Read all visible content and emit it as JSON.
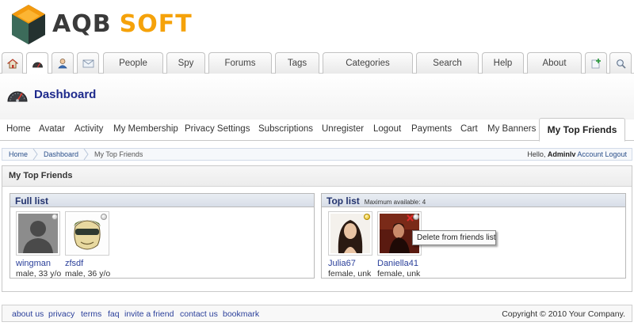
{
  "brand": {
    "name_part1": "AQB",
    "name_part2": "SOFT",
    "color_primary": "#3a3a3a",
    "color_accent": "#f5a20a"
  },
  "topnav": {
    "icon_tabs": [
      "home-icon",
      "dashboard-icon",
      "profile-icon",
      "mail-icon"
    ],
    "tabs": [
      "People",
      "Spy",
      "Forums",
      "Tags",
      "Categories",
      "Search",
      "Help",
      "About"
    ],
    "right_icons": [
      "add-page-icon",
      "search-icon"
    ]
  },
  "page": {
    "title": "Dashboard",
    "title_color": "#1e2a8c"
  },
  "subnav": {
    "items": [
      "Home",
      "Avatar",
      "Activity",
      "My Membership",
      "Privacy Settings",
      "Subscriptions",
      "Unregister",
      "Logout",
      "Payments",
      "Cart",
      "My Banners"
    ],
    "active": "My Top Friends"
  },
  "breadcrumb": {
    "items": [
      "Home",
      "Dashboard"
    ],
    "current": "My Top Friends",
    "hello_prefix": "Hello,",
    "username": "Adminlv",
    "account_link": "Account",
    "logout_link": "Logout"
  },
  "main": {
    "heading": "My Top Friends",
    "full_list": {
      "title": "Full list",
      "friends": [
        {
          "name": "wingman",
          "info": "male, 33 y/o",
          "online": false
        },
        {
          "name": "zfsdf",
          "info": "male, 36 y/o",
          "online": false
        }
      ]
    },
    "top_list": {
      "title": "Top list",
      "max_note": "Maximum available: 4",
      "friends": [
        {
          "name": "Julia67",
          "info": "female, unk",
          "online": true
        },
        {
          "name": "Daniella41",
          "info": "female, unk",
          "online": false
        }
      ]
    },
    "tooltip": "Delete from friends list"
  },
  "footer": {
    "links": [
      "about us",
      "privacy",
      "terms",
      "faq",
      "invite a friend",
      "contact us",
      "bookmark"
    ],
    "copyright": "Copyright © 2010 Your Company."
  }
}
